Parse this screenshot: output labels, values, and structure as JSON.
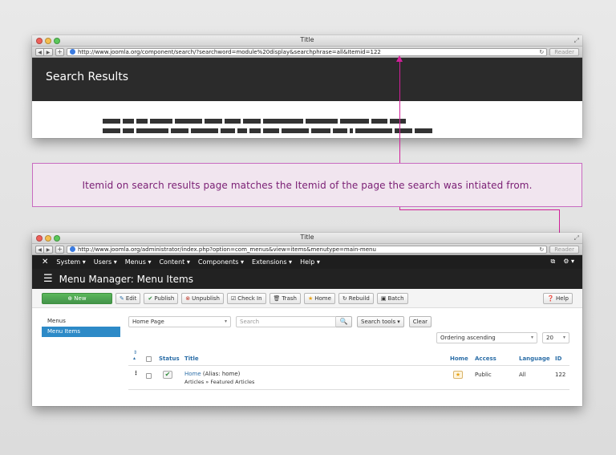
{
  "window1": {
    "title": "Title",
    "url": "http://www.joomla.org/component/search/?searchword=module%20display&searchphrase=all&Itemid=122",
    "reader_label": "Reader",
    "page_heading": "Search Results"
  },
  "annotation": {
    "text": "Itemid on search results page matches the Itemid of the page the search was intiated from."
  },
  "window2": {
    "title": "Title",
    "url": "http://www.joomla.org/administrator/index.php?option=com_menus&view=items&menutype=main-menu",
    "reader_label": "Reader"
  },
  "admin": {
    "menu": [
      "System",
      "Users",
      "Menus",
      "Content",
      "Components",
      "Extensions",
      "Help"
    ],
    "page_title": "Menu Manager: Menu Items",
    "toolbar": {
      "new": "New",
      "edit": "Edit",
      "publish": "Publish",
      "unpublish": "Unpublish",
      "checkin": "Check In",
      "trash": "Trash",
      "home": "Home",
      "rebuild": "Rebuild",
      "batch": "Batch",
      "help": "Help"
    },
    "sidebar": [
      "Menus",
      "Menu Items"
    ],
    "filters": {
      "menu_select": "Home Page",
      "search_placeholder": "Search",
      "search_tools": "Search tools",
      "clear": "Clear",
      "ordering": "Ordering ascending",
      "limit": "20"
    },
    "table": {
      "headers": {
        "status": "Status",
        "title": "Title",
        "home": "Home",
        "access": "Access",
        "language": "Language",
        "id": "ID"
      },
      "rows": [
        {
          "title": "Home",
          "alias": "(Alias: home)",
          "category": "Articles » Featured Articles",
          "access": "Public",
          "language": "All",
          "id": "122"
        }
      ]
    }
  },
  "colors": {
    "accent": "#d2209a",
    "annotation_bg": "#f1e5ef",
    "annotation_text": "#7a1e74",
    "joomla_nav": "#1e1e1e",
    "new_button": "#5bb75b",
    "active_sidebar": "#2d8ac7"
  }
}
